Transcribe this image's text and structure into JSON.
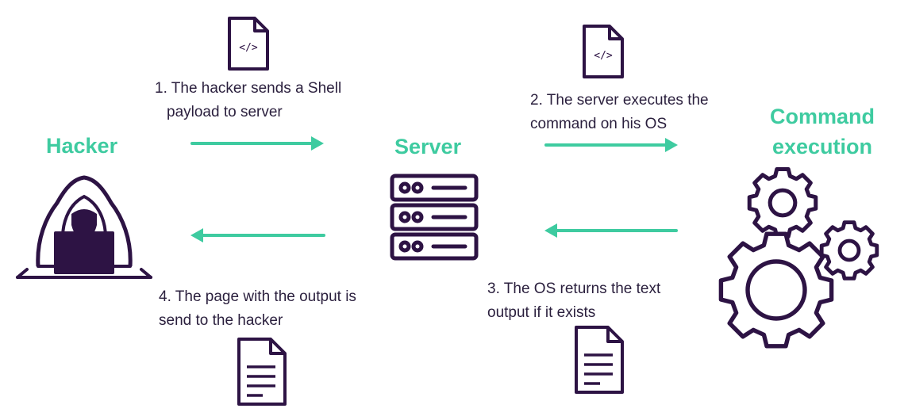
{
  "colors": {
    "accent": "#3ecba0",
    "ink": "#2d1344",
    "text": "#2a1f3d"
  },
  "nodes": {
    "hacker": {
      "label": "Hacker",
      "icon": "hooded-hacker-icon"
    },
    "server": {
      "label": "Server",
      "icon": "server-rack-icon"
    },
    "command": {
      "label_line1": "Command",
      "label_line2": "execution",
      "icon": "gears-icon"
    }
  },
  "steps": [
    {
      "line1": "1. The hacker sends a Shell",
      "line2": "payload to server",
      "icon": "code-file-icon",
      "direction": "right"
    },
    {
      "line1": "2. The server executes the",
      "line2": "command on his OS",
      "icon": "code-file-icon",
      "direction": "right"
    },
    {
      "line1": "3. The OS returns the text",
      "line2": "output if it exists",
      "icon": "text-document-icon",
      "direction": "left"
    },
    {
      "line1": "4. The page with the output is",
      "line2": "send to the hacker",
      "icon": "text-document-icon",
      "direction": "left"
    }
  ],
  "code_glyph": "</>"
}
